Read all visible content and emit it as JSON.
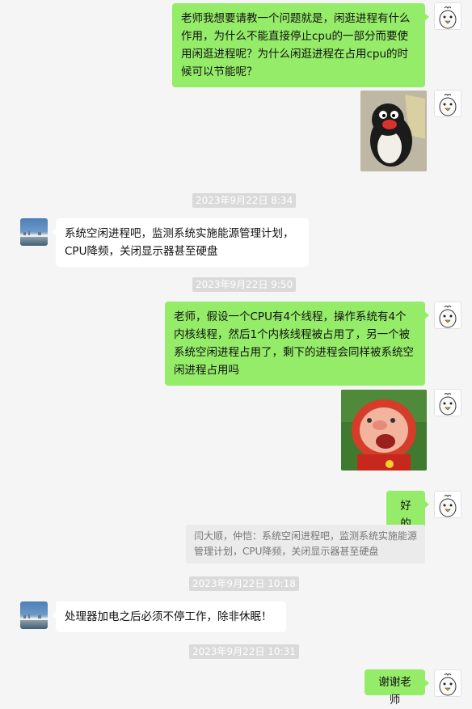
{
  "chat": {
    "messages": [
      {
        "sender": "me",
        "type": "text",
        "text": "老师我想要请教一个问题就是，闲逛进程有什么作用，为什么不能直接停止cpu的一部分而要使用闲逛进程呢？为什么闲逛进程在占用cpu的时候可以节能呢？"
      },
      {
        "sender": "me",
        "type": "sticker",
        "sticker": "penguin-sticker"
      },
      {
        "type": "time",
        "text": "2023年9月22日 8:34"
      },
      {
        "sender": "teacher",
        "type": "text",
        "text": "系统空闲进程吧，监测系统实施能源管理计划，CPU降频，关闭显示器甚至硬盘"
      },
      {
        "type": "time",
        "text": "2023年9月22日 9:50"
      },
      {
        "sender": "me",
        "type": "text",
        "text": "老师，假设一个CPU有4个线程，操作系统有4个内核线程，然后1个内核线程被占用了，另一个被系统空闲进程占用了，剩下的进程会同样被系统空闲进程占用吗"
      },
      {
        "sender": "me",
        "type": "sticker",
        "sticker": "pig-sticker"
      },
      {
        "sender": "me",
        "type": "text",
        "text": "好的"
      },
      {
        "type": "quote",
        "text": "闫大顺，仲恺：系统空闲进程吧，监测系统实施能源管理计划，CPU降频，关闭显示器甚至硬盘"
      },
      {
        "type": "time",
        "text": "2023年9月22日 10:18"
      },
      {
        "sender": "teacher",
        "type": "text",
        "text": "处理器加电之后必须不停工作，除非休眠！"
      },
      {
        "type": "time",
        "text": "2023年9月22日 10:31"
      },
      {
        "sender": "me",
        "type": "text",
        "text": "谢谢老师"
      }
    ]
  },
  "colors": {
    "background": "#f5f5f5",
    "my_bubble": "#95ec69",
    "their_bubble": "#ffffff",
    "timestamp_bg": "#dadada",
    "quote_bg": "#ebebeb"
  }
}
